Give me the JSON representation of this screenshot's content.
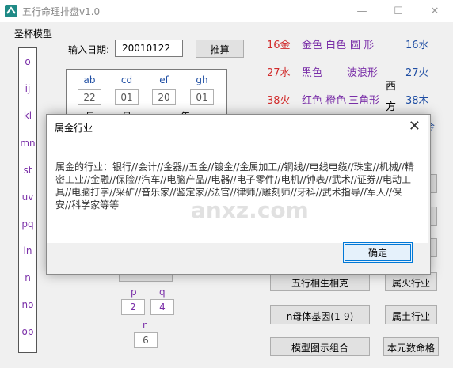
{
  "window": {
    "title": "五行命理排盘v1.0",
    "minimize": "—",
    "maximize": "☐",
    "close": "✕"
  },
  "groupbox": {
    "title": "圣杯模型",
    "items": [
      "o",
      "ij",
      "kl",
      "mn",
      "st",
      "uv",
      "pq",
      "ln",
      "n",
      "no",
      "op"
    ]
  },
  "date": {
    "label": "输入日期:",
    "value": "20010122",
    "button": "推算"
  },
  "panel": {
    "headers": [
      "ab",
      "cd",
      "ef",
      "gh"
    ],
    "values": [
      "22",
      "01",
      "20",
      "01"
    ],
    "sub_labels": [
      "日",
      "月",
      "年"
    ]
  },
  "elements": {
    "row1": {
      "num": "16金",
      "colors": "金色 白色",
      "shape": "圆 形",
      "right": "16水"
    },
    "row2": {
      "num": "27水",
      "colors": "黑色",
      "shape": "波浪形",
      "right": "27火"
    },
    "row3": {
      "num": "38火",
      "colors": "红色 橙色",
      "shape": "三角形",
      "right": "38木"
    },
    "vertical_direction": "西方",
    "right4": "金"
  },
  "pqr": {
    "p_label": "p",
    "q_label": "q",
    "p_value": "2",
    "q_value": "4",
    "r_label": "r",
    "r_value": "6"
  },
  "buttons": {
    "wuxing": "五行相生相克",
    "fire_industry": "属火行业",
    "mother_base": "n母体基因(1-9)",
    "earth_industry": "属土行业",
    "model_combo": "模型图示组合",
    "ben_yuan": "本元数命格"
  },
  "dialog": {
    "title": "属金行业",
    "message": "属金的行业：银行//会计//金器//五金//镀金//金属加工//铜线//电线电缆//珠宝//机械//精密工业//金融//保险//汽车//电脑产品//电器//电子零件//电机//钟表//武术//证券//电动工具//电脑打字//采矿//音乐家//鉴定家//法官//律师//雕刻师//牙科//武术指导//军人//保安//科学家等等",
    "ok": "确定",
    "close": "✕"
  },
  "watermark": "anxz.com"
}
